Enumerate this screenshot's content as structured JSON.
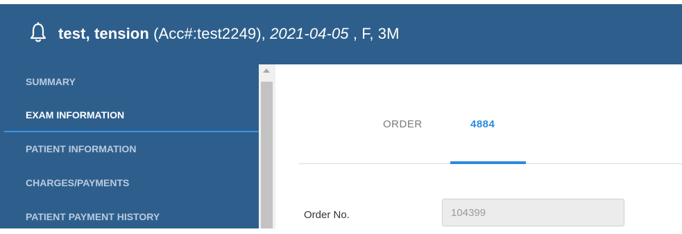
{
  "header": {
    "name": "test, tension",
    "account": " (Acc#:test2249), ",
    "date": "2021-04-05",
    "rest": " , F, 3M"
  },
  "sidebar": {
    "items": [
      {
        "label": "SUMMARY",
        "active": false
      },
      {
        "label": "EXAM INFORMATION",
        "active": true
      },
      {
        "label": "PATIENT INFORMATION",
        "active": false
      },
      {
        "label": "CHARGES/PAYMENTS",
        "active": false
      },
      {
        "label": "PATIENT PAYMENT HISTORY",
        "active": false
      }
    ]
  },
  "tabs": [
    {
      "label": "ORDER",
      "active": false
    },
    {
      "label": "4884",
      "active": true
    }
  ],
  "form": {
    "order_no_label": "Order No.",
    "order_no_value": "104399"
  },
  "colors": {
    "header_bg": "#2e5f8c",
    "accent": "#2a8ae0",
    "sidebar_active_line": "#3a95e8"
  },
  "icons": {
    "notification": "bell-icon"
  }
}
